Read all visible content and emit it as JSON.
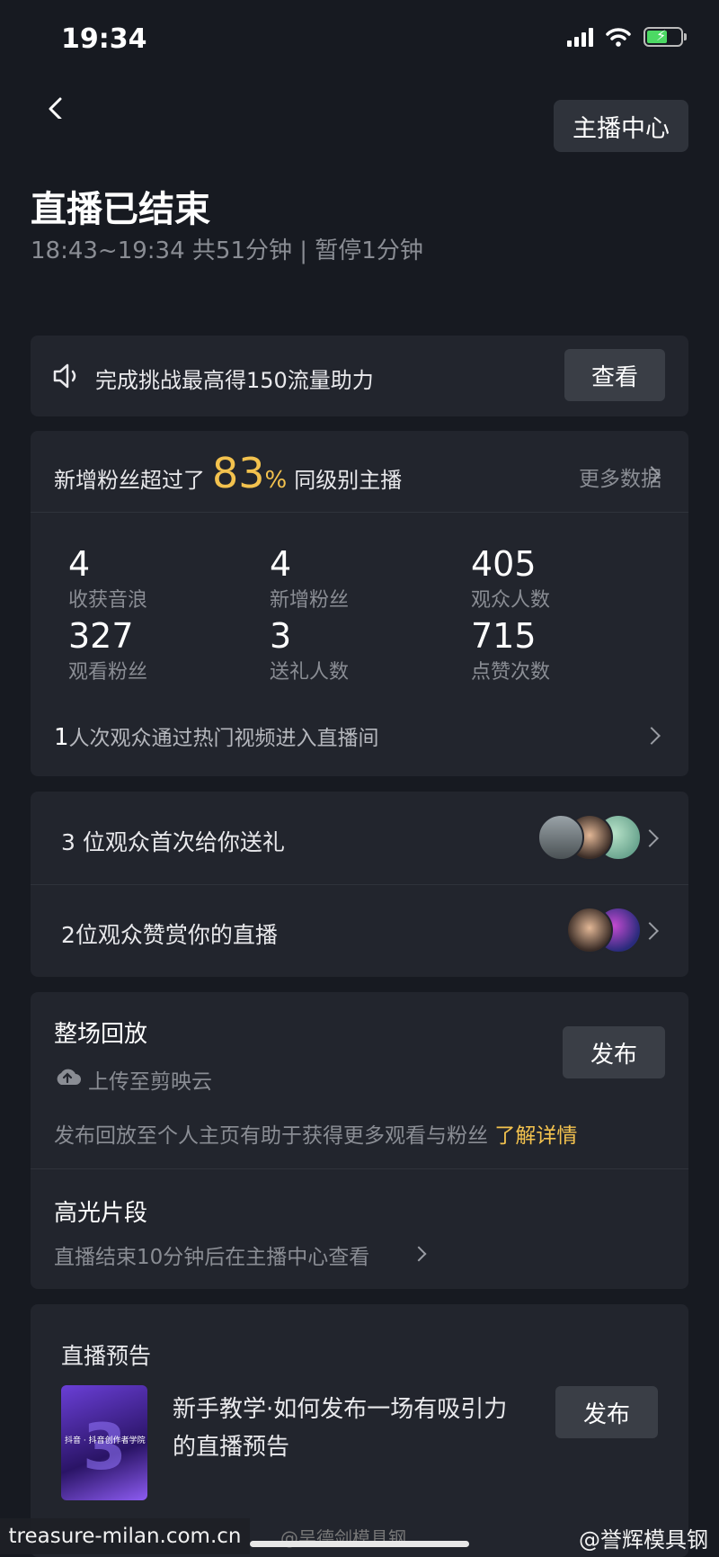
{
  "status_bar": {
    "time": "19:34"
  },
  "header": {
    "anchor_center_label": "主播中心"
  },
  "summary": {
    "title": "直播已结束",
    "subtitle": "18:43~19:34 共51分钟 | 暂停1分钟"
  },
  "challenge": {
    "text": "完成挑战最高得150流量助力",
    "button": "查看"
  },
  "stats": {
    "head_prefix": "新增粉丝超过了",
    "head_pct": "83",
    "head_pct_unit": "%",
    "head_suffix": "同级别主播",
    "more_label": "更多数据",
    "metrics": [
      {
        "value": "4",
        "label": "收获音浪"
      },
      {
        "value": "4",
        "label": "新增粉丝"
      },
      {
        "value": "405",
        "label": "观众人数"
      },
      {
        "value": "327",
        "label": "观看粉丝"
      },
      {
        "value": "3",
        "label": "送礼人数"
      },
      {
        "value": "715",
        "label": "点赞次数"
      }
    ],
    "hot_count": "1",
    "hot_text": "人次观众通过热门视频进入直播间"
  },
  "gifts": {
    "first_gift_text": "3 位观众首次给你送礼",
    "praise_text": "2位观众赞赏你的直播"
  },
  "replay": {
    "title": "整场回放",
    "upload_text": "上传至剪映云",
    "button": "发布",
    "desc": "发布回放至个人主页有助于获得更多观看与粉丝",
    "learn_more": "了解详情",
    "highlight_title": "高光片段",
    "highlight_desc": "直播结束10分钟后在主播中心查看"
  },
  "preview": {
    "title": "直播预告",
    "thumb_caption": "抖音 · 抖音创作者学院",
    "text": "新手教学·如何发布一场有吸引力的直播预告",
    "button": "发布"
  },
  "watermarks": {
    "site": "treasure-milan.com.cn",
    "weibo1": "@吴德剑模具钢",
    "weibo2": "@誉辉模具钢"
  },
  "colors": {
    "accent": "#f3c24e",
    "background": "#171a21",
    "card": "#22252d"
  }
}
